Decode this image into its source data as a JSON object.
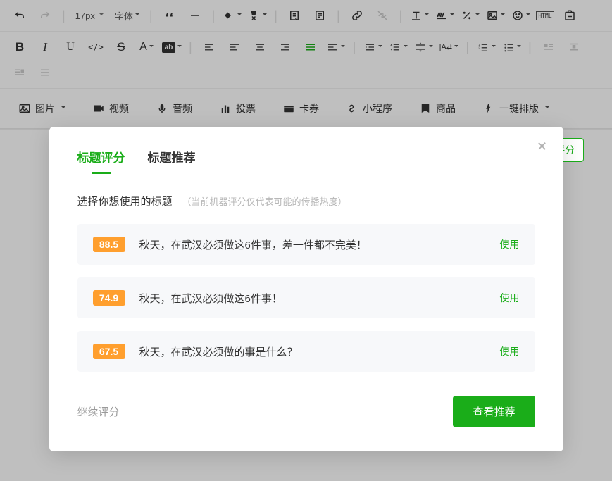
{
  "toolbar": {
    "font_size": "17px",
    "font_family": "字体",
    "ab_label": "ab"
  },
  "insert": {
    "image": "图片",
    "video": "视频",
    "audio": "音频",
    "vote": "投票",
    "card": "卡券",
    "miniapp": "小程序",
    "product": "商品",
    "autolayout": "一键排版"
  },
  "floating_score_btn": "评分",
  "modal": {
    "tabs": {
      "score": "标题评分",
      "recommend": "标题推荐"
    },
    "subhead": "选择你想使用的标题",
    "hint": "（当前机器评分仅代表可能的传播热度）",
    "use_label": "使用",
    "continue": "继续评分",
    "view_recommend": "查看推荐",
    "titles": [
      {
        "score": "88.5",
        "text": "秋天，在武汉必须做这6件事，差一件都不完美！"
      },
      {
        "score": "74.9",
        "text": "秋天，在武汉必须做这6件事！"
      },
      {
        "score": "67.5",
        "text": "秋天，在武汉必须做的事是什么？"
      }
    ]
  }
}
